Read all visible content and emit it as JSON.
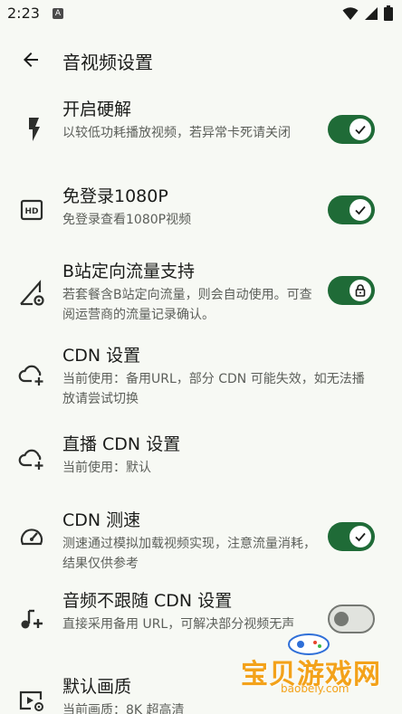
{
  "status_bar": {
    "time": "2:23",
    "notif_glyph": "A"
  },
  "app_bar": {
    "title": "音视频设置"
  },
  "settings": [
    {
      "title": "开启硬解",
      "subtitle": "以较低功耗播放视频，若异常卡死请关闭",
      "icon": "bolt-icon",
      "control": "switch",
      "state": "on-check"
    },
    {
      "title": "免登录1080P",
      "subtitle": "免登录查看1080P视频",
      "icon": "hd-icon",
      "control": "switch",
      "state": "on-check"
    },
    {
      "title": "B站定向流量支持",
      "subtitle": "若套餐含B站定向流量，则会自动使用。可查阅运营商的流量记录确认。",
      "icon": "signal-settings-icon",
      "control": "switch",
      "state": "on-lock"
    },
    {
      "title": "CDN 设置",
      "subtitle": "当前使用：备用URL，部分 CDN 可能失效，如无法播放请尝试切换",
      "icon": "cloud-add-icon",
      "control": "none"
    },
    {
      "title": "直播 CDN 设置",
      "subtitle": "当前使用：默认",
      "icon": "cloud-add-icon",
      "control": "none"
    },
    {
      "title": "CDN 测速",
      "subtitle": "测速通过模拟加载视频实现，注意流量消耗，结果仅供参考",
      "icon": "speedometer-icon",
      "control": "switch",
      "state": "on-check"
    },
    {
      "title": "音频不跟随 CDN 设置",
      "subtitle": "直接采用备用 URL，可解决部分视频无声",
      "icon": "music-add-icon",
      "control": "switch",
      "state": "off"
    },
    {
      "title": "默认画质",
      "subtitle": "当前画质：8K 超高清",
      "icon": "video-settings-icon",
      "control": "none"
    }
  ],
  "watermark": {
    "cn": "宝贝游戏网",
    "en": "baobeiy.com"
  },
  "colors": {
    "background": "#f7f9f4",
    "switch_on": "#1f6b37",
    "switch_off_track": "#e1e3de",
    "text_primary": "#1b1c1a",
    "text_secondary": "#5c5f5a"
  }
}
